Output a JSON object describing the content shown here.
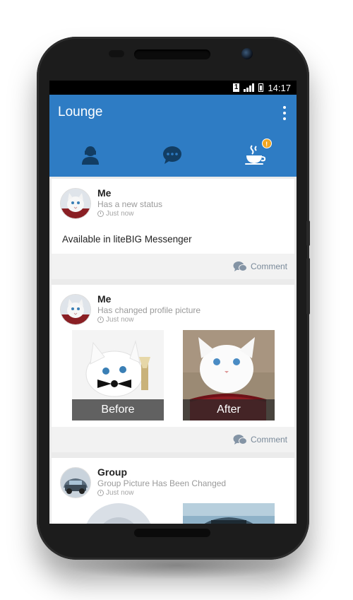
{
  "statusbar": {
    "sim": "1",
    "time": "14:17"
  },
  "app": {
    "title": "Lounge",
    "accent": "#2e7cc4",
    "badge_color": "#f2a620"
  },
  "tabs": [
    {
      "icon": "person-icon",
      "badge": ""
    },
    {
      "icon": "chat-bubble-icon",
      "badge": "!"
    },
    {
      "icon": "coffee-cup-icon",
      "badge": "!"
    }
  ],
  "posts": [
    {
      "name": "Me",
      "status": "Has a new status",
      "time": "Just now",
      "text": "Available in liteBIG Messenger",
      "comment_label": "Comment"
    },
    {
      "name": "Me",
      "status": "Has changed profile picture",
      "time": "Just now",
      "photos": [
        {
          "caption": "Before"
        },
        {
          "caption": "After"
        }
      ],
      "comment_label": "Comment"
    },
    {
      "name": "Group",
      "status": "Group Picture Has Been Changed",
      "time": "Just now"
    }
  ]
}
